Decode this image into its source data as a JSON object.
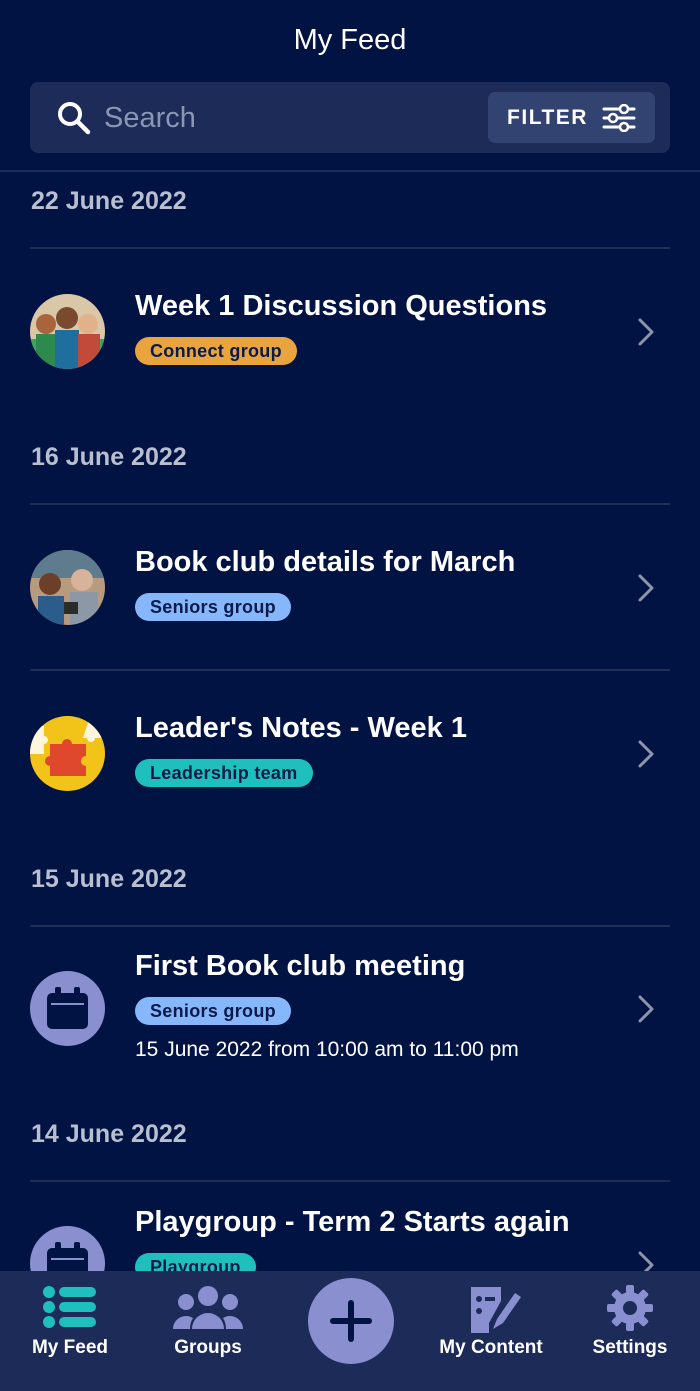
{
  "header": {
    "title": "My Feed",
    "search_placeholder": "Search",
    "filter_label": "FILTER"
  },
  "sections": [
    {
      "date": "22 June 2022",
      "items": [
        {
          "title": "Week 1 Discussion Questions",
          "tag": "Connect group",
          "tag_color": "#eaa43d",
          "avatar": "group-photo"
        }
      ]
    },
    {
      "date": "16 June 2022",
      "items": [
        {
          "title": "Book club details for March",
          "tag": "Seniors group",
          "tag_color": "#87b7fb",
          "avatar": "seniors-photo"
        },
        {
          "title": "Leader's Notes - Week 1",
          "tag": "Leadership team",
          "tag_color": "#1fbfbe",
          "avatar": "puzzle-image"
        }
      ]
    },
    {
      "date": "15 June 2022",
      "items": [
        {
          "title": "First Book club meeting",
          "tag": "Seniors group",
          "tag_color": "#87b7fb",
          "avatar": "calendar-icon",
          "subtitle": "15 June 2022 from 10:00 am to 11:00 pm"
        }
      ]
    },
    {
      "date": "14 June 2022",
      "items": [
        {
          "title": "Playgroup - Term 2 Starts again",
          "tag": "Playgroup",
          "tag_color": "#1fbfbe",
          "avatar": "calendar-icon"
        }
      ]
    }
  ],
  "bottom_nav": {
    "items": [
      {
        "label": "My Feed",
        "icon": "list-icon",
        "active": true
      },
      {
        "label": "Groups",
        "icon": "people-icon"
      },
      {
        "label": "",
        "icon": "plus-icon"
      },
      {
        "label": "My Content",
        "icon": "edit-document-icon"
      },
      {
        "label": "Settings",
        "icon": "gear-icon"
      }
    ]
  },
  "colors": {
    "background": "#011343",
    "surface": "#1c2b58",
    "accent_teal": "#1fbfbe",
    "accent_purple": "#8a8fd0"
  }
}
